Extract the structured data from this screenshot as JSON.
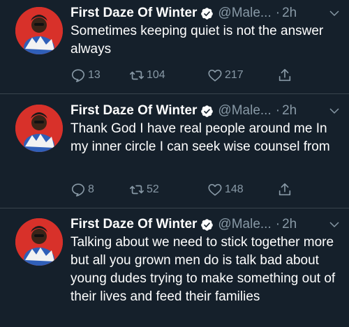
{
  "colors": {
    "background": "#15202b",
    "divider": "#38444d",
    "text": "#ffffff",
    "secondary": "#8899a6",
    "verified": "#ffffff",
    "avatar_bg": "#d8312a"
  },
  "tweets": [
    {
      "author_name": "First Daze Of Winter",
      "handle": "@Male...",
      "separator": "·",
      "time": "2h",
      "text": "Sometimes keeping quiet is not the answer always",
      "replies": "13",
      "retweets": "104",
      "likes": "217",
      "icons": [
        "reply-icon",
        "retweet-icon",
        "like-icon",
        "share-icon"
      ]
    },
    {
      "author_name": "First Daze Of Winter",
      "handle": "@Male...",
      "separator": "·",
      "time": "2h",
      "text": "Thank God I have real people around me In my inner circle I can seek wise counsel from",
      "replies": "8",
      "retweets": "52",
      "likes": "148",
      "icons": [
        "reply-icon",
        "retweet-icon",
        "like-icon",
        "share-icon"
      ]
    },
    {
      "author_name": "First Daze Of Winter",
      "handle": "@Male...",
      "separator": "·",
      "time": "2h",
      "text": "Talking about we need to stick together more but all you grown men do is talk bad about young dudes trying to make something out of their lives and feed their families"
    }
  ]
}
